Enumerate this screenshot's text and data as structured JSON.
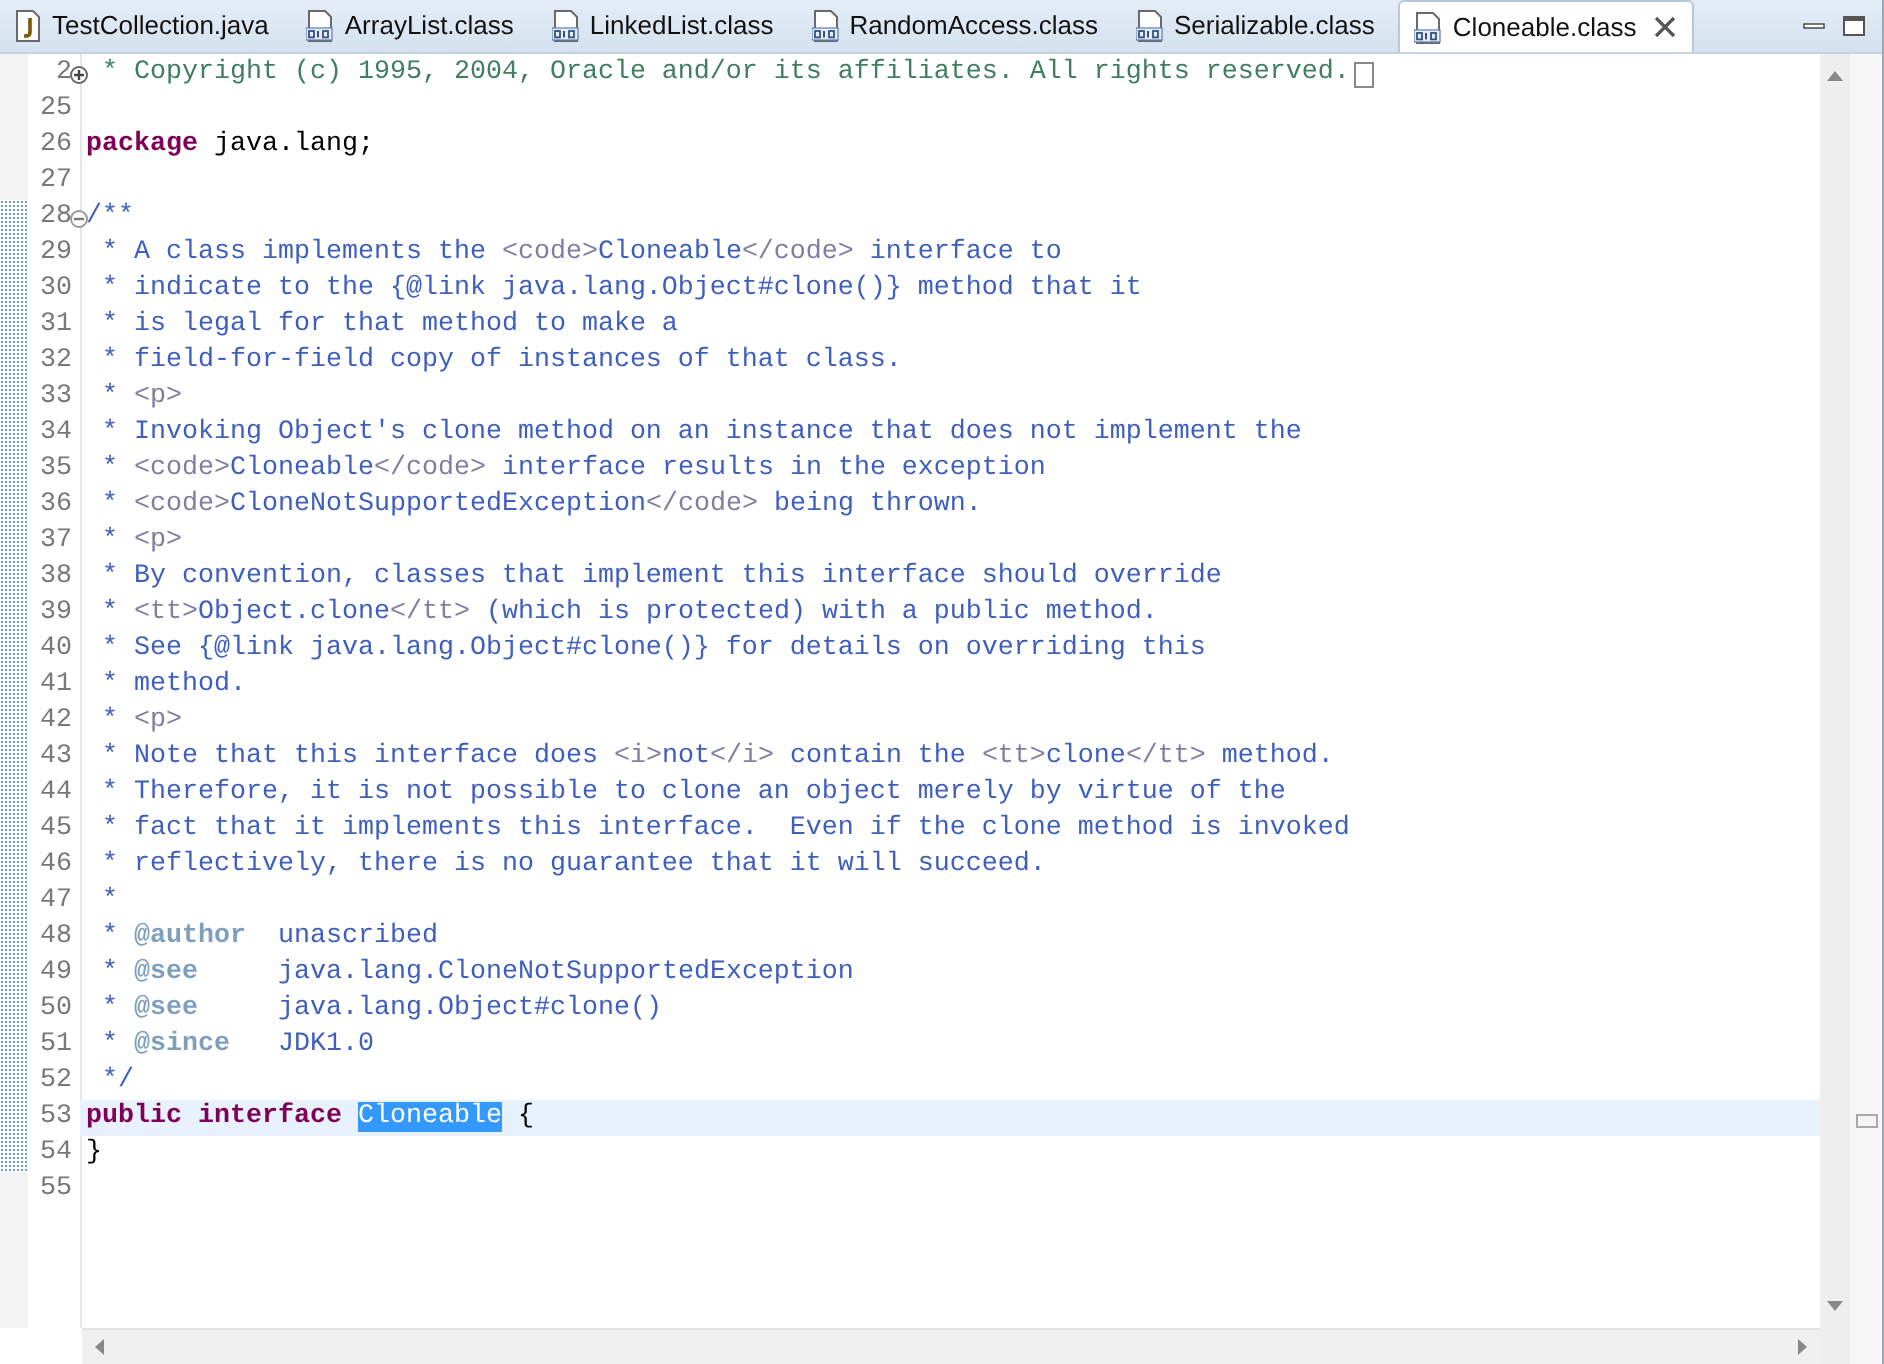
{
  "tabs": [
    {
      "label": "TestCollection.java",
      "kind": "java",
      "selected": false
    },
    {
      "label": "ArrayList.class",
      "kind": "class",
      "selected": false
    },
    {
      "label": "LinkedList.class",
      "kind": "class",
      "selected": false
    },
    {
      "label": "RandomAccess.class",
      "kind": "class",
      "selected": false
    },
    {
      "label": "Serializable.class",
      "kind": "class",
      "selected": false
    },
    {
      "label": "Cloneable.class",
      "kind": "class",
      "selected": true
    }
  ],
  "lines": [
    {
      "number": "2",
      "fold": {
        "collapsed": true
      },
      "changed": false,
      "current": false,
      "segments": [
        {
          "kind": "comment",
          "text": " * Copyright (c) 1995, 2004, Oracle and/or its affiliates. All rights reserved."
        }
      ]
    },
    {
      "number": "25",
      "changed": false,
      "current": false
    },
    {
      "number": "26",
      "changed": false,
      "current": false,
      "segments": [
        {
          "kind": "keyword",
          "text": "package"
        },
        {
          "kind": "plain",
          "text": " java.lang;"
        }
      ]
    },
    {
      "number": "27",
      "changed": false,
      "current": false
    },
    {
      "number": "28",
      "fold": {
        "collapsed": false
      },
      "changed": true,
      "current": false,
      "segments": [
        {
          "kind": "doc",
          "text": "/**"
        }
      ]
    },
    {
      "number": "29",
      "changed": true,
      "current": false,
      "segments": [
        {
          "kind": "doc",
          "text": " * A class implements the "
        },
        {
          "kind": "html",
          "text": "<code>"
        },
        {
          "kind": "doc",
          "text": "Cloneable"
        },
        {
          "kind": "html",
          "text": "</code>"
        },
        {
          "kind": "doc",
          "text": " interface to"
        }
      ]
    },
    {
      "number": "30",
      "changed": true,
      "current": false,
      "segments": [
        {
          "kind": "doc",
          "text": " * indicate to the {@link java.lang.Object#clone()} method that it"
        }
      ]
    },
    {
      "number": "31",
      "changed": true,
      "current": false,
      "segments": [
        {
          "kind": "doc",
          "text": " * is legal for that method to make a"
        }
      ]
    },
    {
      "number": "32",
      "changed": true,
      "current": false,
      "segments": [
        {
          "kind": "doc",
          "text": " * field-for-field copy of instances of that class."
        }
      ]
    },
    {
      "number": "33",
      "changed": true,
      "current": false,
      "segments": [
        {
          "kind": "doc",
          "text": " * "
        },
        {
          "kind": "html",
          "text": "<p>"
        }
      ]
    },
    {
      "number": "34",
      "changed": true,
      "current": false,
      "segments": [
        {
          "kind": "doc",
          "text": " * Invoking Object's clone method on an instance that does not implement the"
        }
      ]
    },
    {
      "number": "35",
      "changed": true,
      "current": false,
      "segments": [
        {
          "kind": "doc",
          "text": " * "
        },
        {
          "kind": "html",
          "text": "<code>"
        },
        {
          "kind": "doc",
          "text": "Cloneable"
        },
        {
          "kind": "html",
          "text": "</code>"
        },
        {
          "kind": "doc",
          "text": " interface results in the exception"
        }
      ]
    },
    {
      "number": "36",
      "changed": true,
      "current": false,
      "segments": [
        {
          "kind": "doc",
          "text": " * "
        },
        {
          "kind": "html",
          "text": "<code>"
        },
        {
          "kind": "doc",
          "text": "CloneNotSupportedException"
        },
        {
          "kind": "html",
          "text": "</code>"
        },
        {
          "kind": "doc",
          "text": " being thrown."
        }
      ]
    },
    {
      "number": "37",
      "changed": true,
      "current": false,
      "segments": [
        {
          "kind": "doc",
          "text": " * "
        },
        {
          "kind": "html",
          "text": "<p>"
        }
      ]
    },
    {
      "number": "38",
      "changed": true,
      "current": false,
      "segments": [
        {
          "kind": "doc",
          "text": " * By convention, classes that implement this interface should override"
        }
      ]
    },
    {
      "number": "39",
      "changed": true,
      "current": false,
      "segments": [
        {
          "kind": "doc",
          "text": " * "
        },
        {
          "kind": "html",
          "text": "<tt>"
        },
        {
          "kind": "doc",
          "text": "Object.clone"
        },
        {
          "kind": "html",
          "text": "</tt>"
        },
        {
          "kind": "doc",
          "text": " (which is protected) with a public method."
        }
      ]
    },
    {
      "number": "40",
      "changed": true,
      "current": false,
      "segments": [
        {
          "kind": "doc",
          "text": " * See {@link java.lang.Object#clone()} for details on overriding this"
        }
      ]
    },
    {
      "number": "41",
      "changed": true,
      "current": false,
      "segments": [
        {
          "kind": "doc",
          "text": " * method."
        }
      ]
    },
    {
      "number": "42",
      "changed": true,
      "current": false,
      "segments": [
        {
          "kind": "doc",
          "text": " * "
        },
        {
          "kind": "html",
          "text": "<p>"
        }
      ]
    },
    {
      "number": "43",
      "changed": true,
      "current": false,
      "segments": [
        {
          "kind": "doc",
          "text": " * Note that this interface does "
        },
        {
          "kind": "html",
          "text": "<i>"
        },
        {
          "kind": "doc",
          "text": "not"
        },
        {
          "kind": "html",
          "text": "</i>"
        },
        {
          "kind": "doc",
          "text": " contain the "
        },
        {
          "kind": "html",
          "text": "<tt>"
        },
        {
          "kind": "doc",
          "text": "clone"
        },
        {
          "kind": "html",
          "text": "</tt>"
        },
        {
          "kind": "doc",
          "text": " method."
        }
      ]
    },
    {
      "number": "44",
      "changed": true,
      "current": false,
      "segments": [
        {
          "kind": "doc",
          "text": " * Therefore, it is not possible to clone an object merely by virtue of the"
        }
      ]
    },
    {
      "number": "45",
      "changed": true,
      "current": false,
      "segments": [
        {
          "kind": "doc",
          "text": " * fact that it implements this interface.  Even if the clone method is invoked"
        }
      ]
    },
    {
      "number": "46",
      "changed": true,
      "current": false,
      "segments": [
        {
          "kind": "doc",
          "text": " * reflectively, there is no guarantee that it will succeed."
        }
      ]
    },
    {
      "number": "47",
      "changed": true,
      "current": false,
      "segments": [
        {
          "kind": "doc",
          "text": " *"
        }
      ]
    },
    {
      "number": "48",
      "changed": true,
      "current": false,
      "segments": [
        {
          "kind": "doc",
          "text": " * "
        },
        {
          "kind": "doctag",
          "text": "@author"
        },
        {
          "kind": "doc",
          "text": "  unascribed"
        }
      ]
    },
    {
      "number": "49",
      "changed": true,
      "current": false,
      "segments": [
        {
          "kind": "doc",
          "text": " * "
        },
        {
          "kind": "doctag",
          "text": "@see"
        },
        {
          "kind": "doc",
          "text": "     java.lang.CloneNotSupportedException"
        }
      ]
    },
    {
      "number": "50",
      "changed": true,
      "current": false,
      "segments": [
        {
          "kind": "doc",
          "text": " * "
        },
        {
          "kind": "doctag",
          "text": "@see"
        },
        {
          "kind": "doc",
          "text": "     java.lang.Object#clone()"
        }
      ]
    },
    {
      "number": "51",
      "changed": true,
      "current": false,
      "segments": [
        {
          "kind": "doc",
          "text": " * "
        },
        {
          "kind": "doctag",
          "text": "@since"
        },
        {
          "kind": "doc",
          "text": "   JDK1.0"
        }
      ]
    },
    {
      "number": "52",
      "changed": true,
      "current": false,
      "segments": [
        {
          "kind": "doc",
          "text": " */"
        }
      ]
    },
    {
      "number": "53",
      "changed": true,
      "current": true,
      "segments": [
        {
          "kind": "keyword",
          "text": "public"
        },
        {
          "kind": "keyword",
          "text": " interface "
        },
        {
          "kind": "occurrence",
          "text": "Cloneable"
        },
        {
          "kind": "plain",
          "text": " {"
        }
      ]
    },
    {
      "number": "54",
      "changed": true,
      "current": false,
      "segments": [
        {
          "kind": "plain",
          "text": "}"
        }
      ]
    },
    {
      "number": "55",
      "changed": false,
      "current": false
    }
  ]
}
